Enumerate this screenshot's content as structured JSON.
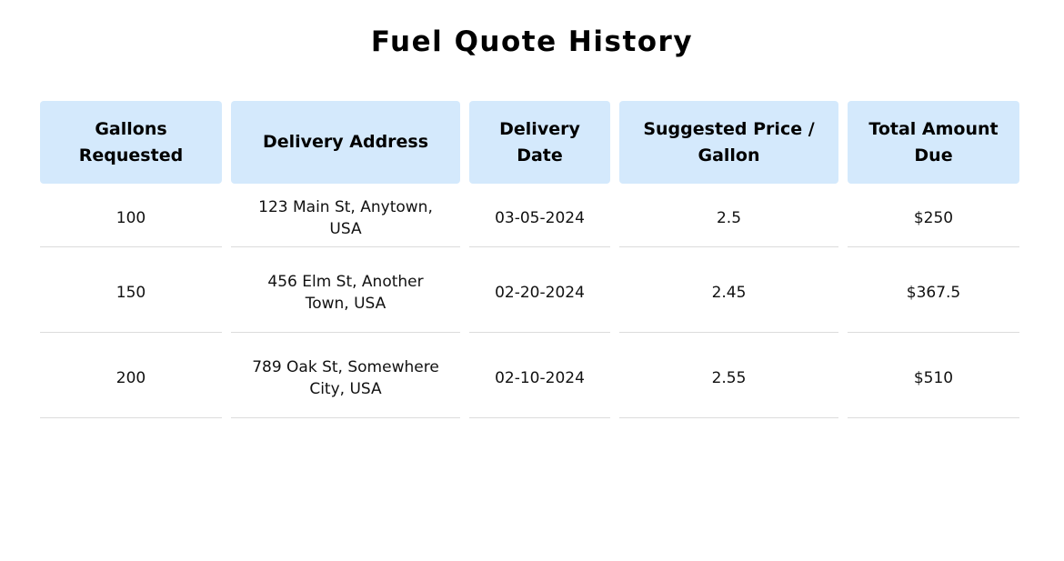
{
  "page": {
    "title": "Fuel Quote History"
  },
  "table": {
    "headers": [
      "Gallons Requested",
      "Delivery Address",
      "Delivery Date",
      "Suggested Price / Gallon",
      "Total Amount Due"
    ],
    "rows": [
      [
        "100",
        "123 Main St, Anytown, USA",
        "03-05-2024",
        "2.5",
        "$250"
      ],
      [
        "150",
        "456 Elm St, Another Town, USA",
        "02-20-2024",
        "2.45",
        "$367.5"
      ],
      [
        "200",
        "789 Oak St, Somewhere City, USA",
        "02-10-2024",
        "2.55",
        "$510"
      ]
    ]
  },
  "colors": {
    "header_background": "#d4e9fc",
    "row_divider": "#dcdcdc",
    "page_background": "#ffffff"
  }
}
